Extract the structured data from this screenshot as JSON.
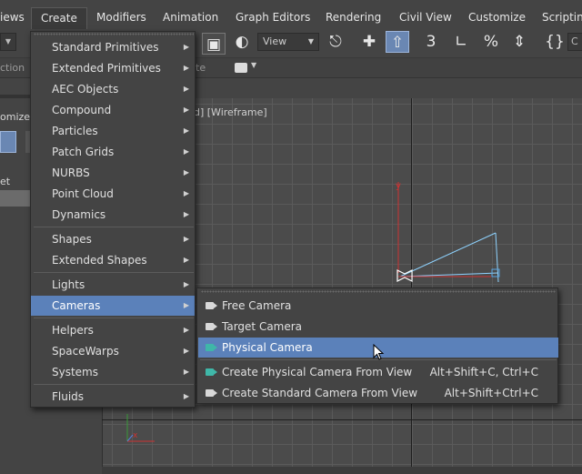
{
  "menubar": {
    "items": [
      {
        "label": "iews",
        "left": 0
      },
      {
        "label": "Create",
        "active": true
      },
      {
        "label": "Modifiers"
      },
      {
        "label": "Animation"
      },
      {
        "label": "Graph Editors"
      },
      {
        "label": "Rendering"
      },
      {
        "label": "Civil View"
      },
      {
        "label": "Customize"
      },
      {
        "label": "Scripting"
      }
    ]
  },
  "toolbar": {
    "view_dropdown": "View",
    "right_field": "C",
    "snap_3": "3",
    "percent": "%"
  },
  "ribbon": {
    "left_text": "ction",
    "mid_text": "te"
  },
  "command_panel": {
    "label_1": "omize",
    "label_2": "et"
  },
  "viewport": {
    "label": "d] [Wireframe]",
    "axis_y": "y",
    "axis_x": "x"
  },
  "create_menu": {
    "items": [
      {
        "label": "Standard Primitives",
        "sub": true
      },
      {
        "label": "Extended Primitives",
        "sub": true
      },
      {
        "label": "AEC Objects",
        "sub": true
      },
      {
        "label": "Compound",
        "sub": true
      },
      {
        "label": "Particles",
        "sub": true
      },
      {
        "label": "Patch Grids",
        "sub": true
      },
      {
        "label": "NURBS",
        "sub": true
      },
      {
        "label": "Point Cloud",
        "sub": true
      },
      {
        "label": "Dynamics",
        "sub": true
      },
      {
        "label": "Shapes",
        "sub": true
      },
      {
        "label": "Extended Shapes",
        "sub": true
      },
      {
        "label": "Lights",
        "sub": true
      },
      {
        "label": "Cameras",
        "sub": true,
        "highlight": true
      },
      {
        "label": "Helpers",
        "sub": true
      },
      {
        "label": "SpaceWarps",
        "sub": true
      },
      {
        "label": "Systems",
        "sub": true
      },
      {
        "label": "Fluids",
        "sub": true
      }
    ]
  },
  "cameras_menu": {
    "items": [
      {
        "label": "Free Camera",
        "shortcut": "",
        "icon": "free-camera-icon"
      },
      {
        "label": "Target Camera",
        "shortcut": "",
        "icon": "target-camera-icon"
      },
      {
        "label": "Physical Camera",
        "shortcut": "",
        "icon": "physical-camera-icon",
        "highlight": true
      },
      {
        "label": "Create Physical Camera From View",
        "shortcut": "Alt+Shift+C, Ctrl+C",
        "icon": "physical-camera-icon"
      },
      {
        "label": "Create Standard Camera From View",
        "shortcut": "Alt+Shift+Ctrl+C",
        "icon": "standard-camera-icon"
      }
    ]
  },
  "colors": {
    "highlight": "#5b81ba",
    "menu_bg": "#444444",
    "accent_teal": "#3fb7a8"
  }
}
